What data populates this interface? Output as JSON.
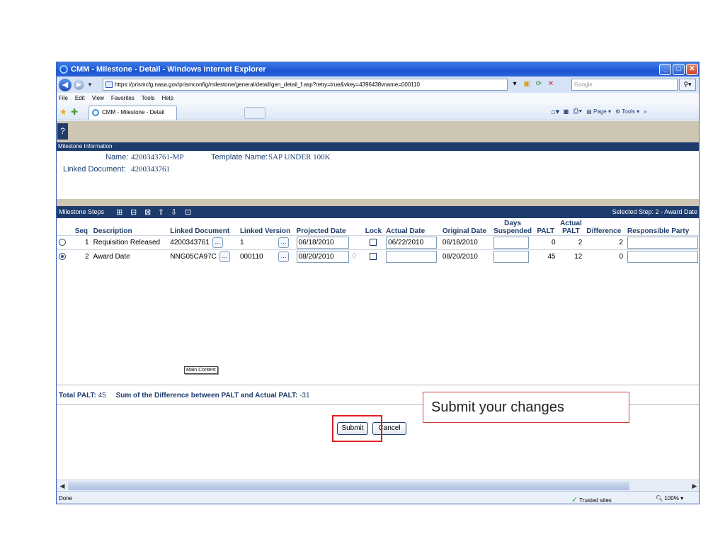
{
  "window": {
    "title": "CMM - Milestone - Detail - Windows Internet Explorer",
    "controls": [
      "minimize-icon",
      "maximize-icon",
      "close-icon"
    ]
  },
  "addressbar": {
    "url": "https://prismcfg.nasa.gov/prismconfig/milestone/general/detail/gen_detail_f.asp?retry=true&vkey=4396438vname=000110",
    "search_placeholder": "Google"
  },
  "menu": {
    "items": [
      "File",
      "Edit",
      "View",
      "Favorites",
      "Tools",
      "Help"
    ]
  },
  "favorites": {
    "tab_title": "CMM - Milestone - Detail",
    "page_label": "Page",
    "tools_label": "Tools"
  },
  "app": {
    "help_label": "?",
    "milestone_info": {
      "header": "Milestone Information",
      "name_label": "Name:",
      "name_value": "4200343761-MP",
      "template_label": "Template Name:",
      "template_value": "SAP UNDER 100K",
      "linked_doc_label": "Linked Document:",
      "linked_doc_value": "4200343761"
    },
    "steps": {
      "header": "Milestone Steps",
      "selected": "Selected Step: 2 - Award Date",
      "toolbar_icons": [
        "add-step-icon",
        "edit-step-icon",
        "delete-step-icon",
        "move-up-icon",
        "move-down-icon",
        "refresh-icon"
      ],
      "columns": {
        "seq": "Seq",
        "description": "Description",
        "linked_document": "Linked Document",
        "linked_version": "Linked Version",
        "projected_date": "Projected Date",
        "lock": "Lock",
        "actual_date": "Actual Date",
        "original_date": "Original Date",
        "days_suspended": "Days Suspended",
        "palt": "PALT",
        "actual_palt": "Actual PALT",
        "difference": "Difference",
        "responsible_party": "Responsible Party"
      },
      "rows": [
        {
          "seq": "1",
          "description": "Requisition Released",
          "linked_document": "4200343761",
          "linked_version": "1",
          "projected_date": "06/18/2010",
          "actual_date": "06/22/2010",
          "original_date": "06/18/2010",
          "days_suspended": "",
          "palt": "0",
          "actual_palt": "2",
          "difference": "2",
          "responsible_party": "",
          "selected": false
        },
        {
          "seq": "2",
          "description": "Award Date",
          "linked_document": "NNG05CA97C",
          "linked_version": "000110",
          "projected_date": "08/20/2010",
          "actual_date": "",
          "original_date": "08/20/2010",
          "days_suspended": "",
          "palt": "45",
          "actual_palt": "12",
          "difference": "0",
          "responsible_party": "",
          "selected": true
        }
      ],
      "tooltip": "Main Content"
    },
    "totals": {
      "total_palt_label": "Total PALT:",
      "total_palt_value": "45",
      "sum_label": "Sum of the Difference between PALT and Actual PALT:",
      "sum_value": "-31"
    },
    "buttons": {
      "submit": "Submit",
      "cancel": "Cancel"
    }
  },
  "status": {
    "left": "Done",
    "zone": "Trusted sites",
    "zoom": "100%"
  },
  "callout": {
    "text": "Submit your changes"
  }
}
